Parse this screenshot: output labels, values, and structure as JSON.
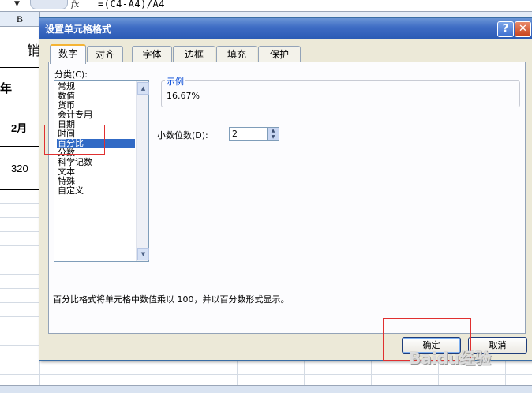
{
  "formula_bar": {
    "dropdown_arrow": "▼",
    "fx": "fx",
    "formula": "=(C4-A4)/A4"
  },
  "column_header": {
    "col_b": "B"
  },
  "background_cells": {
    "sales": "销",
    "year": "年",
    "month": "2月",
    "value": "320"
  },
  "dialog": {
    "title": "设置单元格格式",
    "help_label": "?",
    "close_label": "✕",
    "tabs": [
      "数字",
      "对齐",
      "字体",
      "边框",
      "填充",
      "保护"
    ],
    "active_tab": "数字",
    "category_label": "分类(C):",
    "categories": [
      "常规",
      "数值",
      "货币",
      "会计专用",
      "日期",
      "时间",
      "百分比",
      "分数",
      "科学记数",
      "文本",
      "特殊",
      "自定义"
    ],
    "selected_category": "百分比",
    "sample_title": "示例",
    "sample_value": "16.67%",
    "decimals_label": "小数位数(D):",
    "decimals_value": "2",
    "description": "百分比格式将单元格中数值乘以 100，并以百分数形式显示。",
    "ok_label": "确定",
    "cancel_label": "取消"
  },
  "watermark": "Baidu经验",
  "colors": {
    "titlebar": "#2b5bb5",
    "selection": "#316ac5",
    "annotation": "#e03030",
    "tab_accent": "#f5b434"
  }
}
